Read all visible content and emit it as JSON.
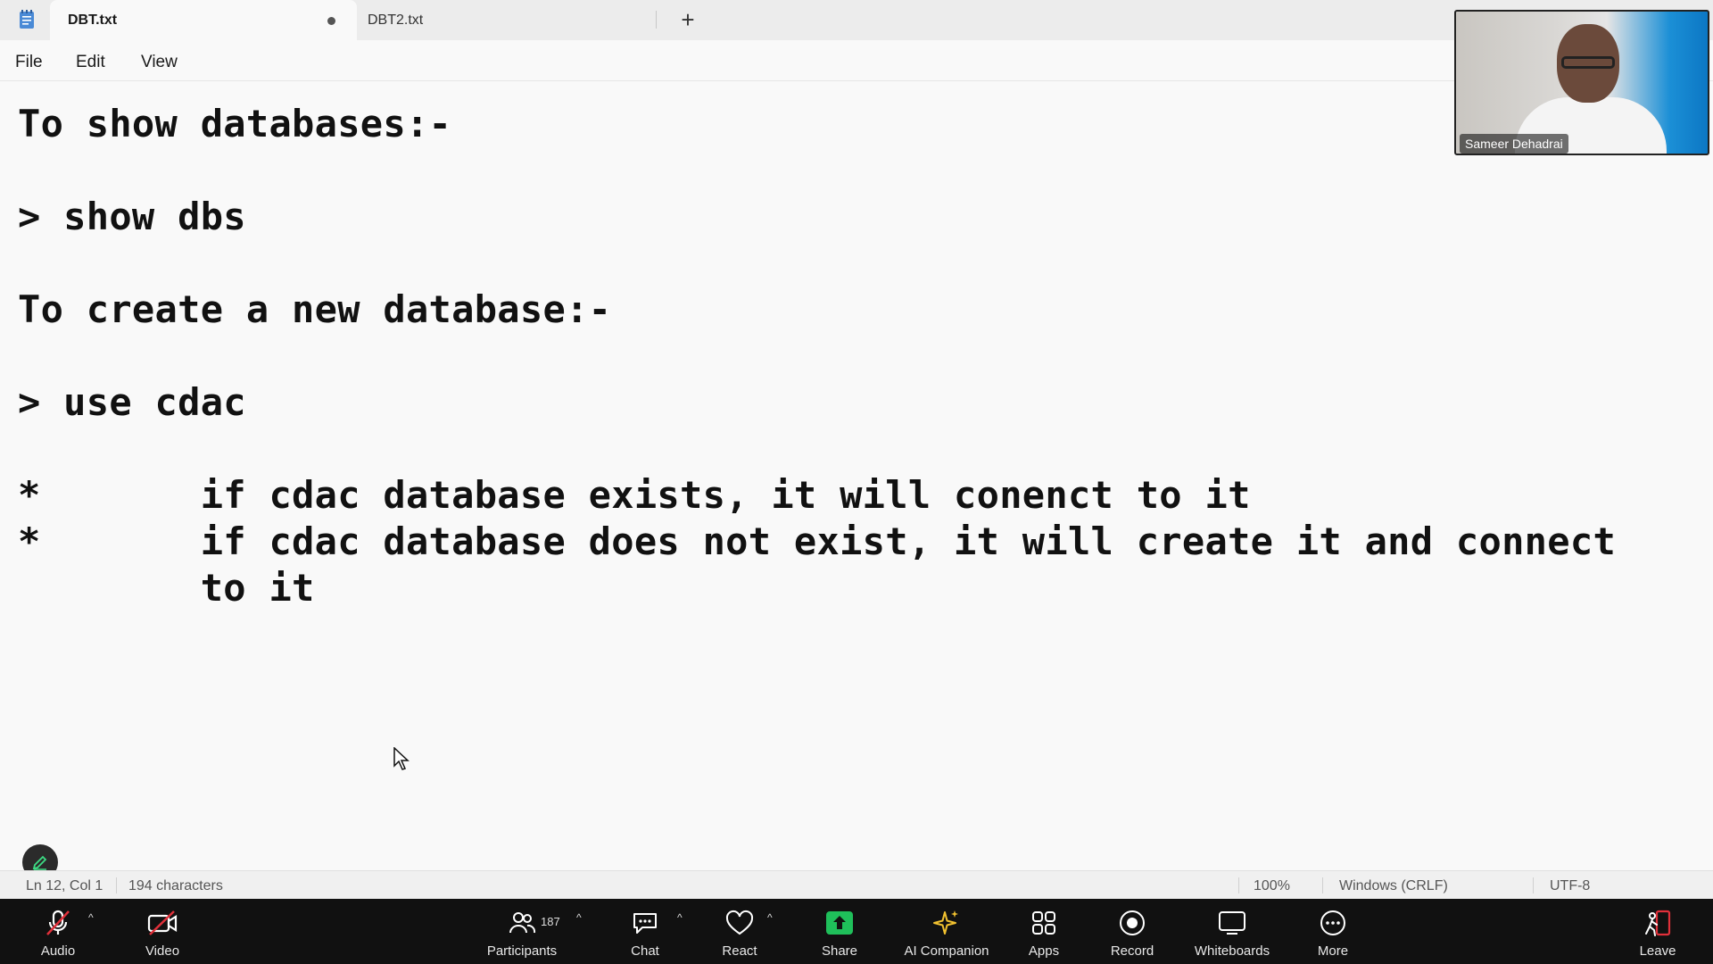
{
  "tabs": [
    {
      "label": "DBT.txt",
      "active": true,
      "unsaved": true
    },
    {
      "label": "DBT2.txt",
      "active": false
    }
  ],
  "new_tab_label": "+",
  "menu": {
    "file": "File",
    "edit": "Edit",
    "view": "View"
  },
  "editor": {
    "lines": [
      "To show databases:-",
      "> show dbs",
      "To create a new database:-",
      "> use cdac",
      "*       if cdac database exists, it will conenct to it",
      "*       if cdac database does not exist, it will create it and connect",
      "        to it"
    ]
  },
  "status": {
    "position": "Ln 12, Col 1",
    "characters": "194 characters",
    "zoom": "100%",
    "line_ending": "Windows (CRLF)",
    "encoding": "UTF-8"
  },
  "video": {
    "participant_name": "Sameer Dehadrai"
  },
  "toolbar": {
    "audio": "Audio",
    "video": "Video",
    "participants": "Participants",
    "participant_count": "187",
    "chat": "Chat",
    "react": "React",
    "share": "Share",
    "ai_companion": "AI Companion",
    "apps": "Apps",
    "record": "Record",
    "whiteboards": "Whiteboards",
    "more": "More",
    "leave": "Leave"
  },
  "colors": {
    "share_green": "#1fbf5a",
    "leave_red": "#e0303a",
    "muted_red": "#e0303a",
    "ai_gold": "#f2c230"
  }
}
